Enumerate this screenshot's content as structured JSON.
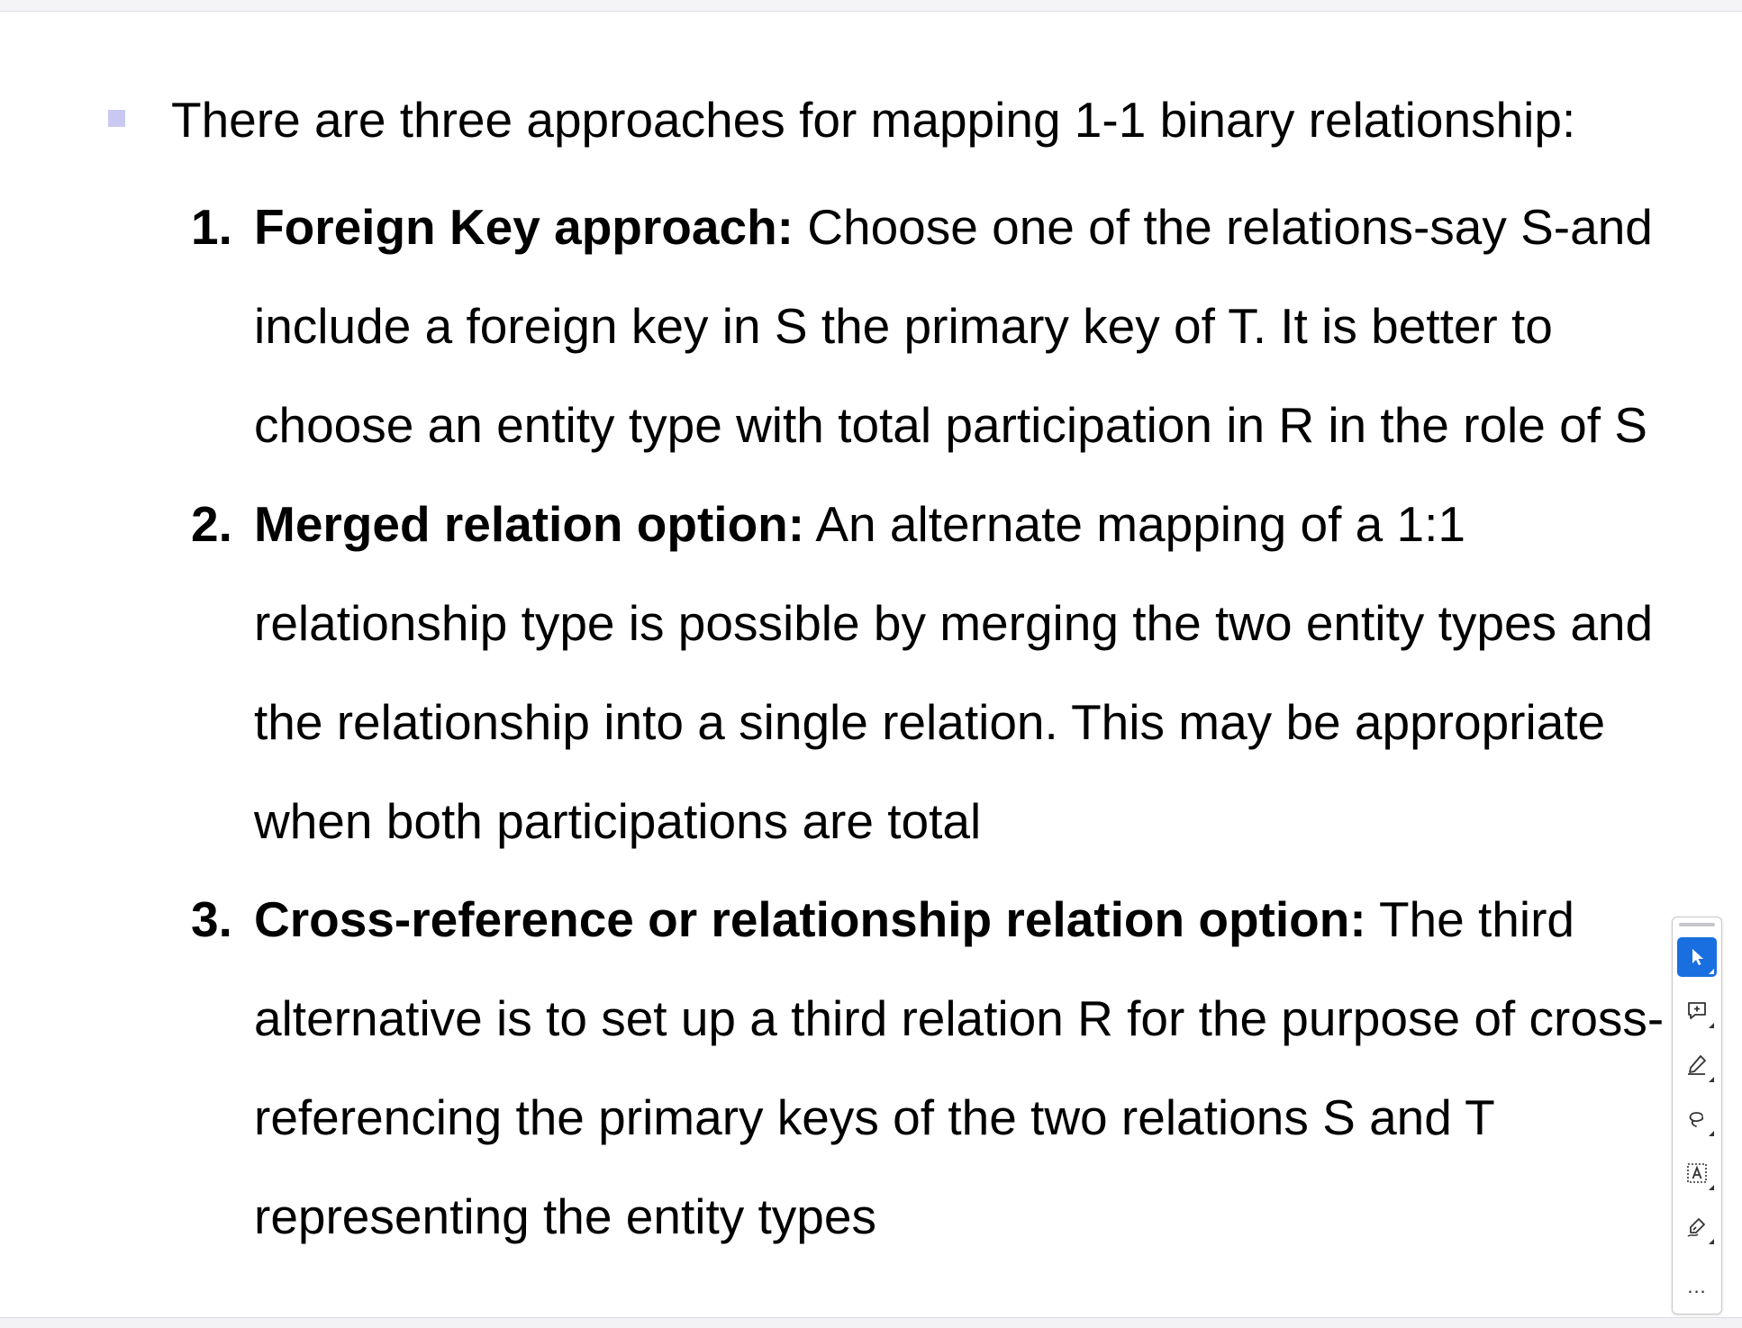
{
  "intro": "There are three approaches for mapping 1-1 binary relationship:",
  "items": [
    {
      "number": "1.",
      "lines": [
        {
          "bold": "Foreign Key approach:",
          "text": " Choose one of the relations-say S-and"
        },
        {
          "bold": "",
          "text": "include a foreign key in S the primary key of T. It is better to"
        },
        {
          "bold": "",
          "text": "choose an entity type with total participation in R in the role of S"
        }
      ]
    },
    {
      "number": "2.",
      "lines": [
        {
          "bold": "Merged relation option:",
          "text": " An alternate mapping of a 1:1"
        },
        {
          "bold": "",
          "text": "relationship type is possible by merging the two entity types and"
        },
        {
          "bold": "",
          "text": "the relationship into a single relation. This may be appropriate"
        },
        {
          "bold": "",
          "text": "when both participations are total"
        }
      ]
    },
    {
      "number": "3.",
      "lines": [
        {
          "bold": "Cross-reference or relationship relation option:",
          "text": " The third"
        },
        {
          "bold": "",
          "text": "alternative is to set up a third relation R for the purpose of cross-"
        },
        {
          "bold": "",
          "text": "referencing the primary keys of the two relations S and T"
        },
        {
          "bold": "",
          "text": "representing the entity types"
        }
      ]
    }
  ],
  "toolbar": {
    "tools": [
      {
        "name": "select-tool",
        "icon": "cursor-arrow-icon",
        "active": true
      },
      {
        "name": "comment-tool",
        "icon": "add-comment-icon",
        "active": false
      },
      {
        "name": "highlight-tool",
        "icon": "pen-highlight-icon",
        "active": false
      },
      {
        "name": "draw-tool",
        "icon": "freehand-lasso-icon",
        "active": false
      },
      {
        "name": "text-box-tool",
        "icon": "text-box-icon",
        "active": false
      },
      {
        "name": "signature-tool",
        "icon": "sign-pen-icon",
        "active": false
      }
    ],
    "more_label": "...",
    "accent_color": "#1a6fe0"
  },
  "colors": {
    "bullet": "#c8c8f2",
    "text": "#000000"
  }
}
